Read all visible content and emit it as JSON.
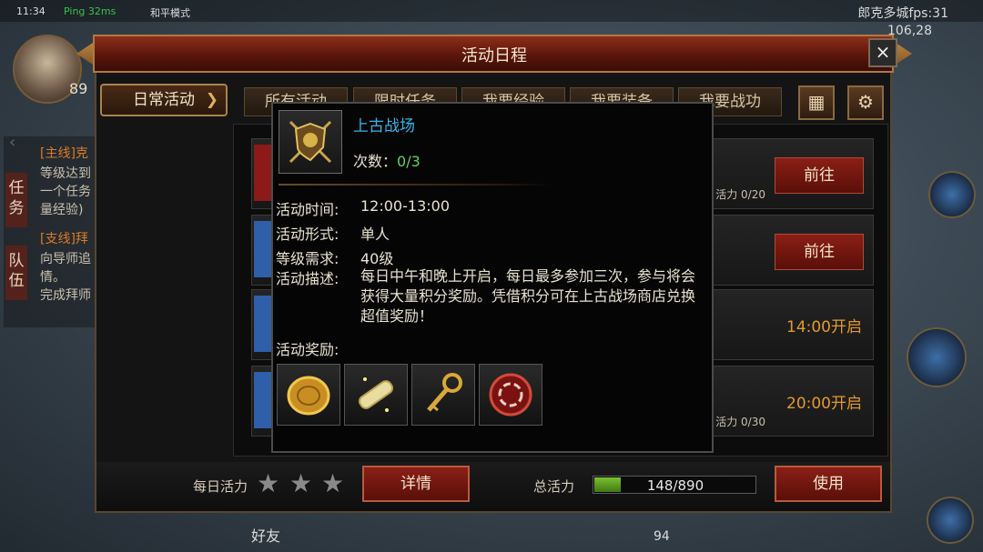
{
  "hud": {
    "time": "11:34",
    "ping": "Ping 32ms",
    "mode": "和平模式",
    "city": "郎克多城fps:31",
    "coord": "106,28",
    "level": "89",
    "bottom_friend": "好友",
    "bottom_num": "94"
  },
  "quest_panel": {
    "tab_task": "任务",
    "tab_team": "队伍",
    "lines": [
      "[主线]克",
      "等级达到",
      "一个任务",
      "量经验)",
      "[支线]拜",
      "向导师追",
      "情。",
      "完成拜师"
    ]
  },
  "window": {
    "title": "活动日程",
    "close": "×",
    "category": "日常活动",
    "category_arrow": "❯",
    "tabs": [
      "所有活动",
      "限时任务",
      "我要经验",
      "我要装备",
      "我要战功"
    ],
    "calendar_icon": "calendar-icon",
    "settings_icon": "gear-icon"
  },
  "rows": [
    {
      "vitality": "活力 0/20",
      "action": "前往"
    },
    {
      "vitality": "",
      "action": "前往"
    },
    {
      "time": "14:00开启"
    },
    {
      "vitality": "活力 0/30",
      "time": "20:00开启"
    }
  ],
  "bottom": {
    "daily_label": "每日活力",
    "stars": [
      "★",
      "★",
      "★"
    ],
    "details_button": "详情",
    "total_label": "总活力",
    "vitality_text": "148/890",
    "vitality_fraction": 0.166,
    "use_button": "使用"
  },
  "popup": {
    "name": "上古战场",
    "count_label": "次数：",
    "count_value": "0/3",
    "time_label": "活动时间:",
    "time_value": "12:00-13:00",
    "form_label": "活动形式:",
    "form_value": "单人",
    "level_label": "等级需求:",
    "level_value": "40级",
    "desc_label": "活动描述:",
    "desc_value": "每日中午和晚上开启，每日最多参加三次，参与将会获得大量积分奖励。凭借积分可在上古战场商店兑换超值奖励！",
    "reward_label": "活动奖励:",
    "rewards": [
      "gold-coin-icon",
      "scroll-icon",
      "golden-key-icon",
      "red-gem-icon"
    ]
  },
  "colors": {
    "title_red": "#8e2e1a",
    "name_blue": "#37b4e8",
    "count_green": "#5fd35f",
    "time_orange": "#e39a2e"
  }
}
